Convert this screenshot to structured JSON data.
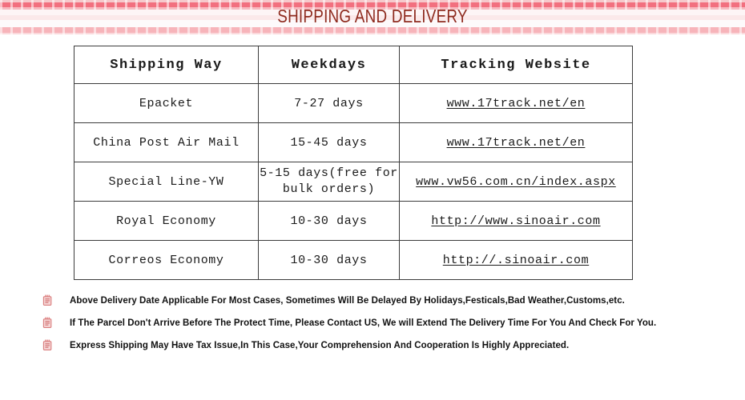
{
  "banner": {
    "title": "SHIPPING AND DELIVERY",
    "title_color": "#8e2a1e",
    "stripe_colors": [
      "#f6c9cc",
      "#f2707f",
      "#f7b9bf",
      "#fdf5f6",
      "#fbe9ea",
      "#fdfafb",
      "#f7b4ba",
      "#fbd9dc"
    ]
  },
  "table": {
    "headers": [
      "Shipping Way",
      "Weekdays",
      "Tracking Website"
    ],
    "rows": [
      {
        "way": "Epacket",
        "days": "7-27 days",
        "days_line2": "",
        "site": "www.17track.net/en"
      },
      {
        "way": "China Post Air Mail",
        "days": "15-45 days",
        "days_line2": "",
        "site": "www.17track.net/en"
      },
      {
        "way": "Special Line-YW",
        "days": "5-15 days(free for",
        "days_line2": "bulk orders)",
        "site": "www.vw56.com.cn/index.aspx"
      },
      {
        "way": "Royal Economy",
        "days": "10-30 days",
        "days_line2": "",
        "site": "http://www.sinoair.com"
      },
      {
        "way": "Correos Economy",
        "days": "10-30 days",
        "days_line2": "",
        "site": "http://.sinoair.com"
      }
    ]
  },
  "notes": {
    "icon_name": "note-document-icon",
    "icon_color": "#e98d8d",
    "items": [
      "Above Delivery Date Applicable For Most Cases, Sometimes Will Be Delayed By Holidays,Festicals,Bad Weather,Customs,etc.",
      "If The Parcel Don't Arrive Before The Protect Time, Please Contact US, We will Extend The Delivery Time For You And Check For You.",
      "Express Shipping May Have Tax Issue,In This Case,Your Comprehension And Cooperation Is Highly Appreciated."
    ]
  }
}
